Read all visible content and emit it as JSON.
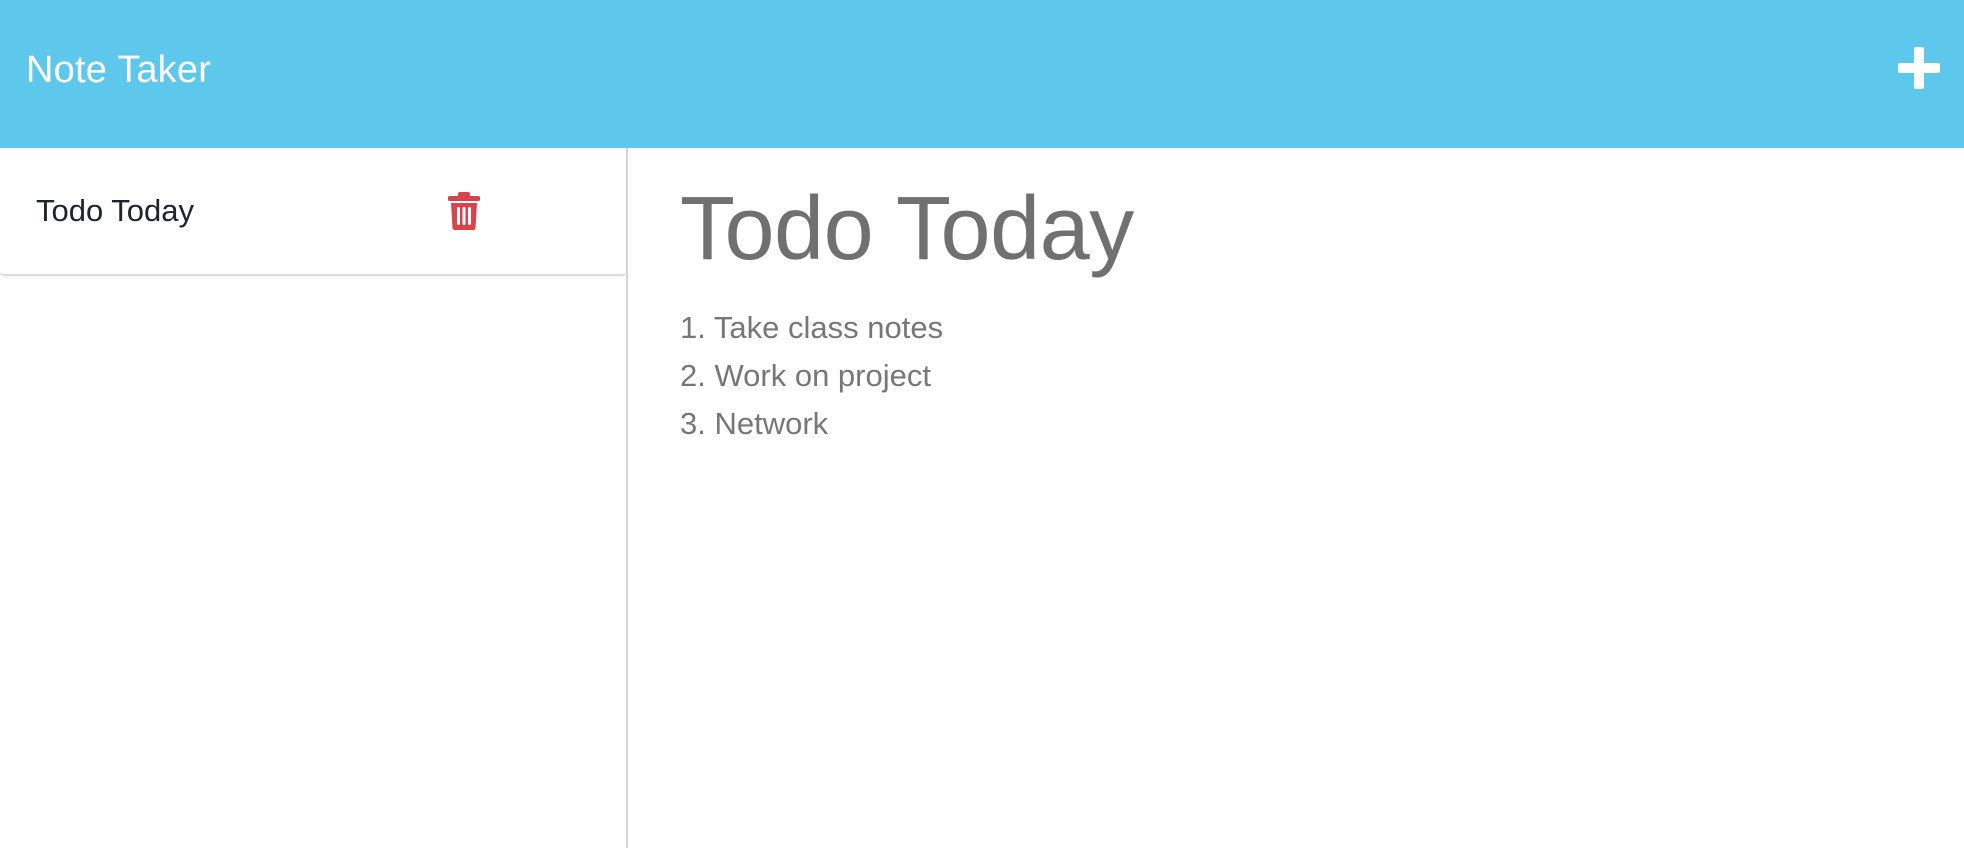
{
  "header": {
    "title": "Note Taker",
    "new_note_icon": "plus-icon",
    "background_color": "#5ec8ec"
  },
  "sidebar": {
    "notes": [
      {
        "title": "Todo Today",
        "delete_icon": "trash-icon",
        "delete_icon_color": "#d9434c"
      }
    ]
  },
  "editor": {
    "title": "Todo Today",
    "body_lines": [
      "1. Take class notes",
      "2. Work on project",
      "3. Network"
    ]
  }
}
